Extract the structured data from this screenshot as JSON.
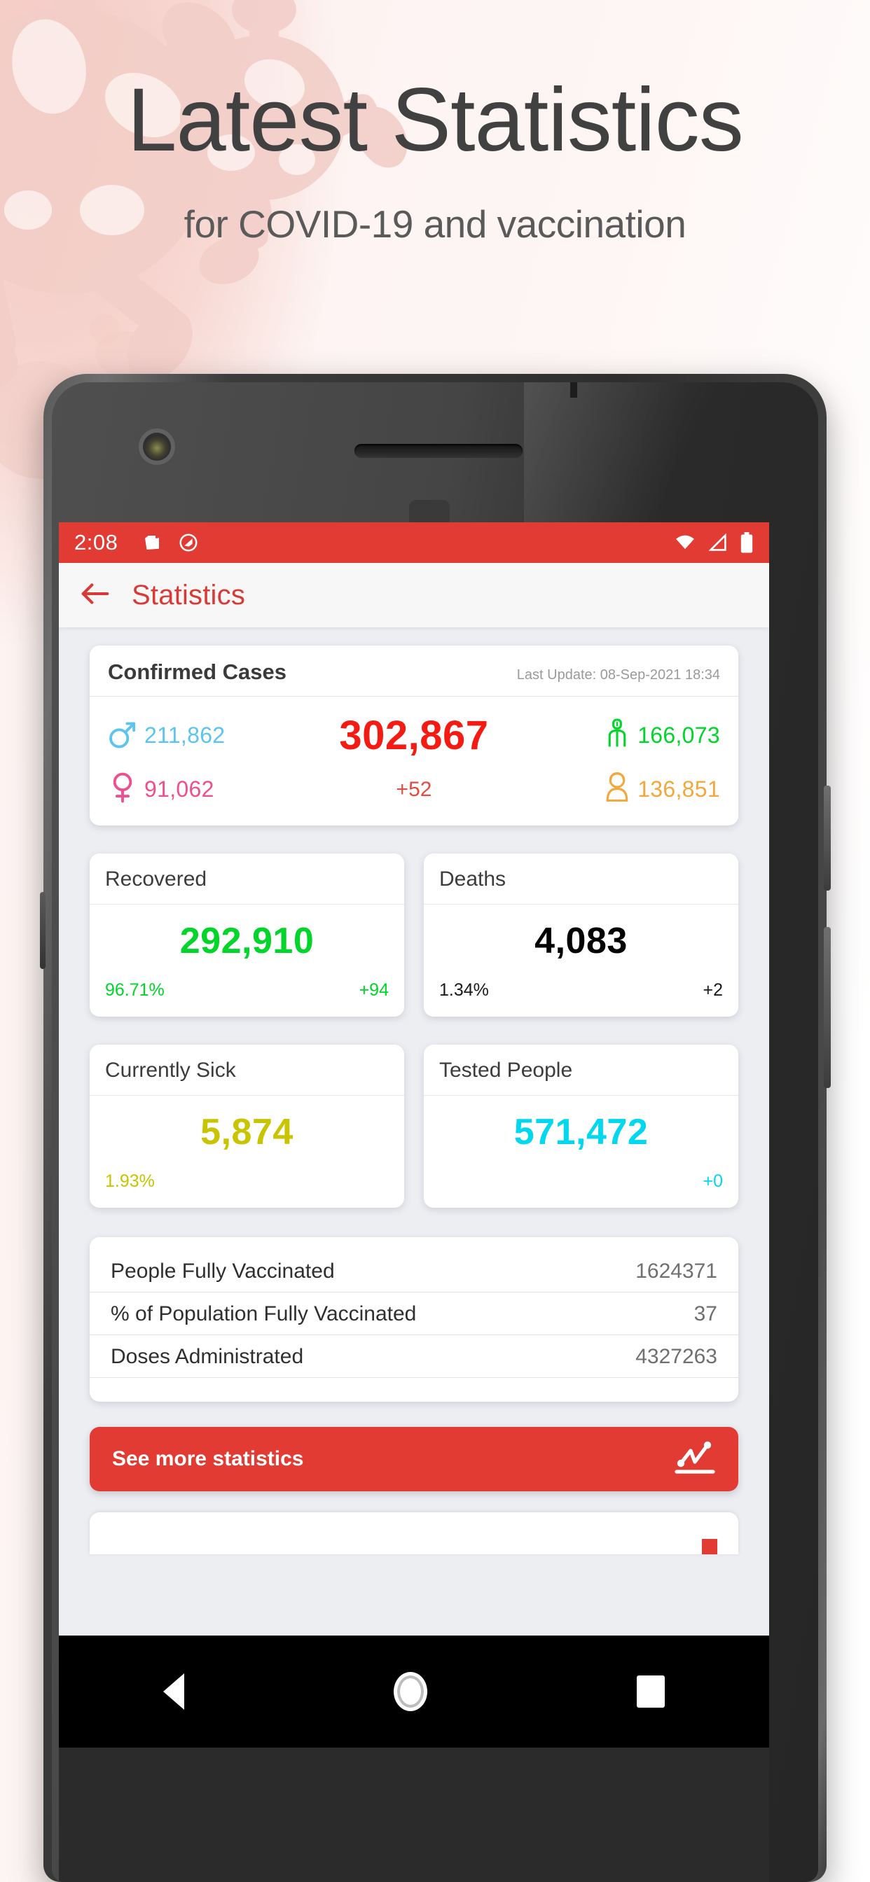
{
  "promo": {
    "title": "Latest Statistics",
    "subtitle": "for COVID-19 and vaccination"
  },
  "colors": {
    "brand_red": "#e23b33",
    "confirmed_red": "#f41c12",
    "recovered_green": "#00d62a",
    "sick_yellow": "#c8c400",
    "tested_cyan": "#00d8f0",
    "male_blue": "#5bc4ef",
    "female_pink": "#ef4f8f",
    "green_person": "#00d62a",
    "orange_person": "#f2a83c",
    "deaths_black": "#000000"
  },
  "status_bar": {
    "time": "2:08",
    "icons_left": [
      "screenshot-icon",
      "do-not-disturb-icon"
    ],
    "icons_right": [
      "wifi-icon",
      "signal-icon",
      "battery-icon"
    ]
  },
  "appbar": {
    "back_label": "back-arrow",
    "title": "Statistics"
  },
  "confirmed_cases": {
    "title": "Confirmed Cases",
    "last_update_label": "Last Update:",
    "last_update_value": "08-Sep-2021 18:34",
    "last_update_full": "Last Update: 08-Sep-2021 18:34",
    "total": "302,867",
    "delta": "+52",
    "male": "211,862",
    "female": "91,062",
    "recovered_person": "166,073",
    "other_person": "136,851"
  },
  "cards": [
    {
      "title": "Recovered",
      "value": "292,910",
      "percent": "96.71%",
      "delta": "+94",
      "color": "#00d62a"
    },
    {
      "title": "Deaths",
      "value": "4,083",
      "percent": "1.34%",
      "delta": "+2",
      "color": "#000000"
    },
    {
      "title": "Currently Sick",
      "value": "5,874",
      "percent": "1.93%",
      "delta": "",
      "color": "#c8c400"
    },
    {
      "title": "Tested People",
      "value": "571,472",
      "percent": "",
      "delta": "+0",
      "color": "#00d8f0"
    }
  ],
  "vaccination_rows": [
    {
      "label": "People Fully Vaccinated",
      "value": "1624371"
    },
    {
      "label": "% of Population Fully Vaccinated",
      "value": "37"
    },
    {
      "label": "Doses Administrated",
      "value": "4327263"
    }
  ],
  "see_more": {
    "label": "See more statistics",
    "icon": "line-chart-icon"
  },
  "navbar": {
    "back": "back-triangle-icon",
    "home": "home-circle-icon",
    "recents": "recents-square-icon"
  }
}
